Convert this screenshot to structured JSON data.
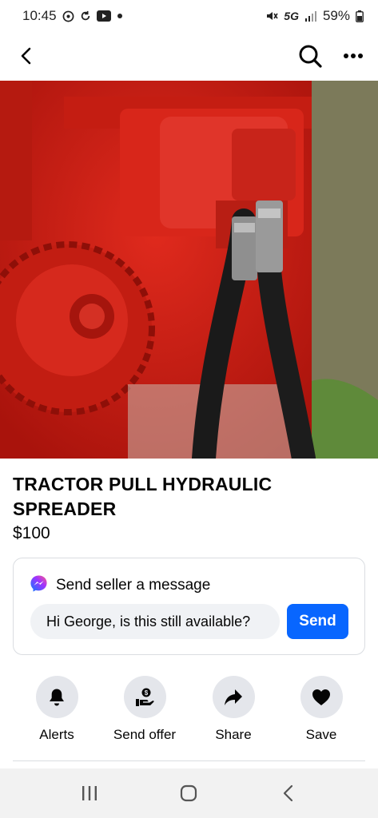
{
  "status_bar": {
    "time": "10:45",
    "network": "5G",
    "battery": "59%",
    "icons": [
      "whatsapp-icon",
      "sync-icon",
      "youtube-icon",
      "dot-icon",
      "mute-icon",
      "signal-icon",
      "battery-icon"
    ]
  },
  "top_bar": {
    "back_icon": "chevron-left-icon",
    "search_icon": "search-icon",
    "more_icon": "more-dots-icon"
  },
  "photo": {
    "description_icon": "listing-photo",
    "pager": {
      "total": 5,
      "active_index": 1
    }
  },
  "listing": {
    "title": "TRACTOR PULL HYDRAULIC SPREADER",
    "price": "$100"
  },
  "message": {
    "heading": "Send seller a message",
    "input_value": "Hi George, is this still available?",
    "send_label": "Send",
    "icon": "messenger-icon"
  },
  "actions": [
    {
      "label": "Alerts",
      "icon": "bell-icon"
    },
    {
      "label": "Send offer",
      "icon": "offer-hand-icon"
    },
    {
      "label": "Share",
      "icon": "share-arrow-icon"
    },
    {
      "label": "Save",
      "icon": "heart-icon"
    }
  ],
  "colors": {
    "accent": "#0866ff",
    "text": "#050505",
    "action_bg": "#e4e6eb",
    "input_bg": "#f0f2f5"
  }
}
